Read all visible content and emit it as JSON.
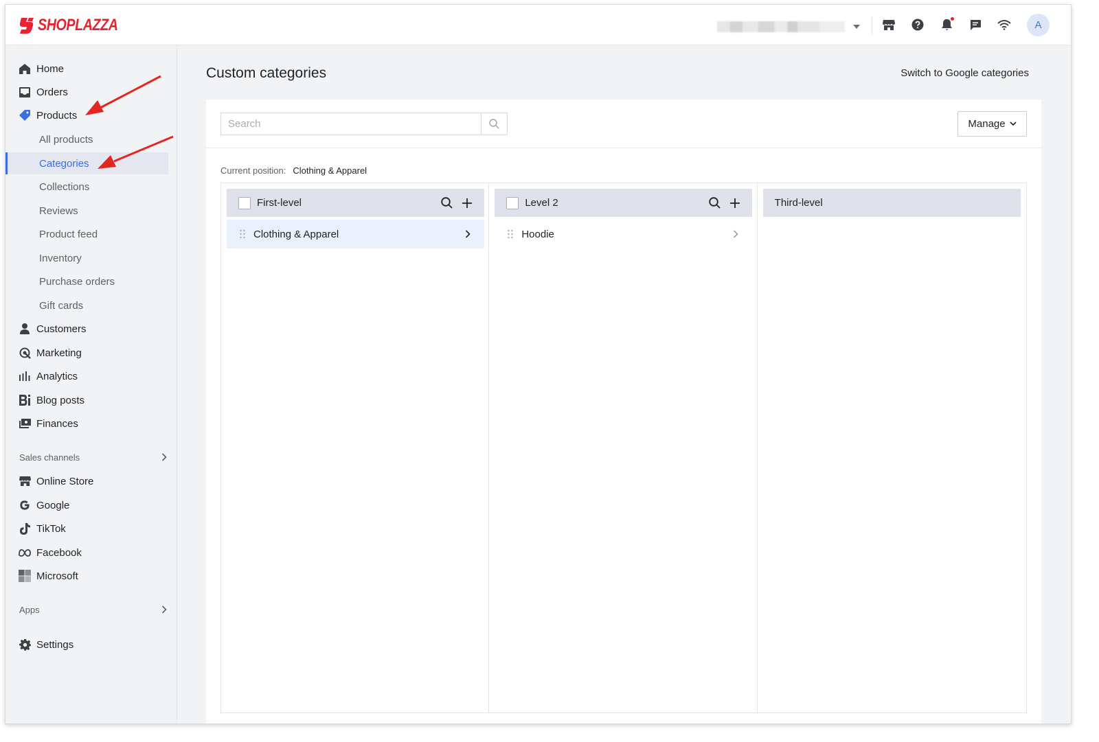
{
  "brand": {
    "name": "SHOPLAZZA",
    "color": "#e8222f"
  },
  "topbar": {
    "avatar_initial": "A",
    "icons": [
      "store-icon",
      "help-icon",
      "bell-icon",
      "chat-icon",
      "wifi-icon"
    ]
  },
  "sidebar": {
    "items": [
      {
        "label": "Home",
        "icon": "home-icon"
      },
      {
        "label": "Orders",
        "icon": "inbox-icon"
      },
      {
        "label": "Products",
        "icon": "tag-icon"
      }
    ],
    "product_sub": [
      {
        "label": "All products"
      },
      {
        "label": "Categories",
        "active": true
      },
      {
        "label": "Collections"
      },
      {
        "label": "Reviews"
      },
      {
        "label": "Product feed"
      },
      {
        "label": "Inventory"
      },
      {
        "label": "Purchase orders"
      },
      {
        "label": "Gift cards"
      }
    ],
    "items2": [
      {
        "label": "Customers",
        "icon": "person-icon"
      },
      {
        "label": "Marketing",
        "icon": "target-icon"
      },
      {
        "label": "Analytics",
        "icon": "bar-chart-icon"
      },
      {
        "label": "Blog posts",
        "icon": "blog-icon"
      },
      {
        "label": "Finances",
        "icon": "finance-icon"
      }
    ],
    "sales_channels_label": "Sales channels",
    "channels": [
      {
        "label": "Online Store",
        "icon": "store-icon"
      },
      {
        "label": "Google",
        "icon": "google-icon"
      },
      {
        "label": "TikTok",
        "icon": "tiktok-icon"
      },
      {
        "label": "Facebook",
        "icon": "meta-icon"
      },
      {
        "label": "Microsoft",
        "icon": "microsoft-icon"
      }
    ],
    "apps_label": "Apps",
    "settings_label": "Settings",
    "accent": "#3b6ee6"
  },
  "main": {
    "title": "Custom categories",
    "switch_link": "Switch to Google categories",
    "search_placeholder": "Search",
    "manage_label": "Manage",
    "position_label": "Current position:",
    "position_value": "Clothing & Apparel",
    "columns": [
      {
        "title": "First-level",
        "items": [
          "Clothing & Apparel"
        ]
      },
      {
        "title": "Level 2",
        "items": [
          "Hoodie"
        ]
      },
      {
        "title": "Third-level",
        "items": []
      }
    ]
  }
}
